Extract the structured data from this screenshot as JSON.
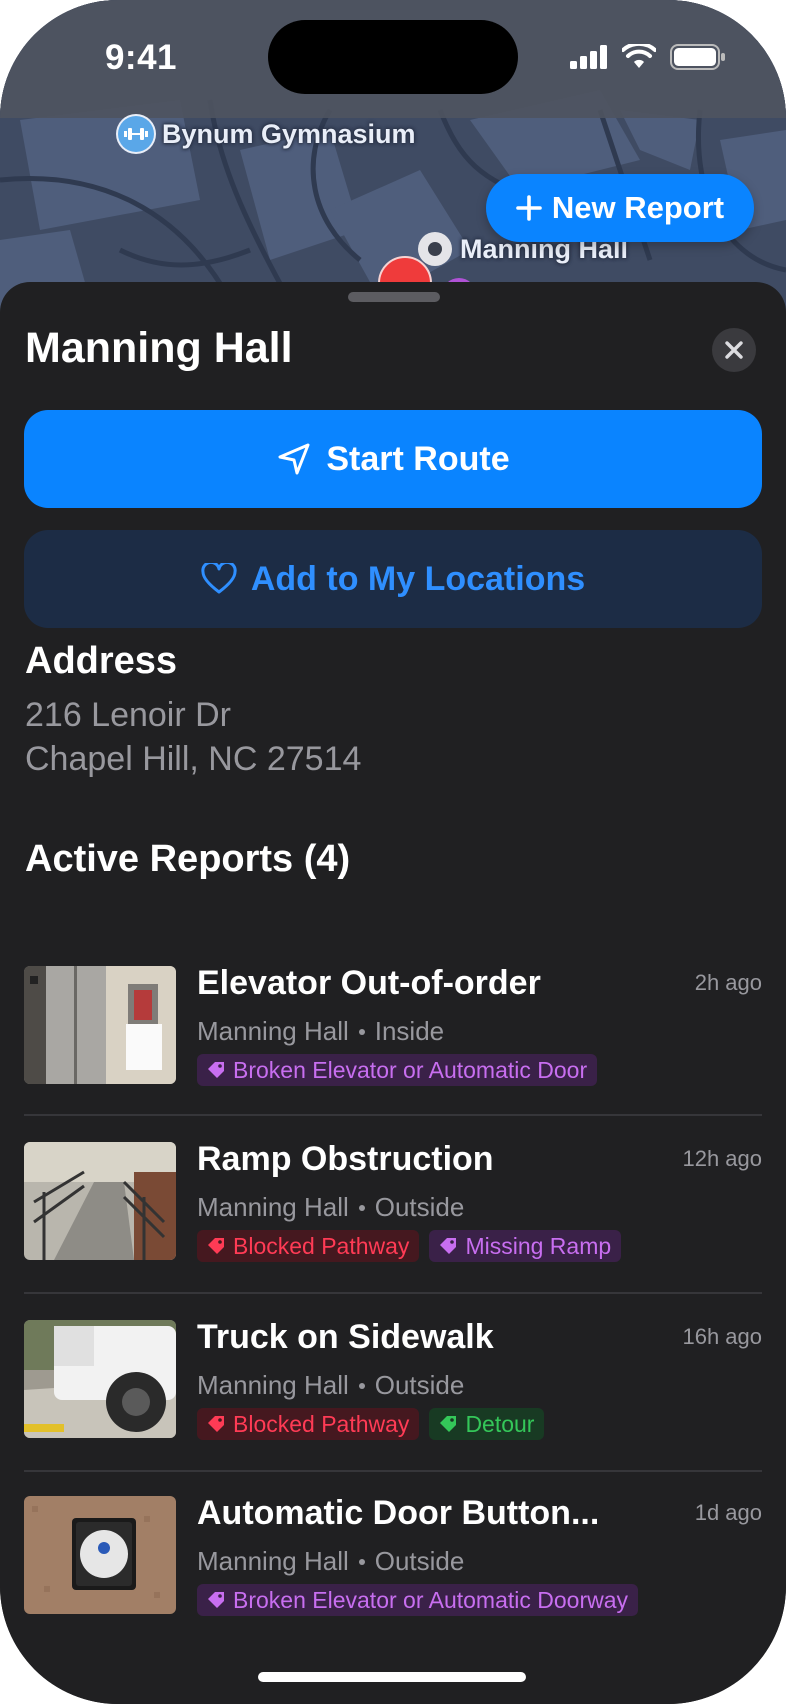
{
  "status_bar": {
    "time": "9:41"
  },
  "map": {
    "poi_gym": "Bynum Gymnasium",
    "poi_manning": "Manning Hall",
    "new_report_label": "New Report"
  },
  "sheet": {
    "title": "Manning Hall",
    "start_route_label": "Start Route",
    "add_location_label": "Add to My Locations",
    "address_heading": "Address",
    "address_line1": "216 Lenoir Dr",
    "address_line2": "Chapel Hill, NC 27514",
    "reports_heading": "Active Reports (4)"
  },
  "reports": [
    {
      "title": "Elevator Out-of-order",
      "time": "2h ago",
      "building": "Manning Hall",
      "location": "Inside",
      "tags": [
        {
          "label": "Broken Elevator or Automatic Door",
          "color": "purple"
        }
      ]
    },
    {
      "title": "Ramp Obstruction",
      "time": "12h ago",
      "building": "Manning Hall",
      "location": "Outside",
      "tags": [
        {
          "label": "Blocked Pathway",
          "color": "red"
        },
        {
          "label": "Missing Ramp",
          "color": "purple"
        }
      ]
    },
    {
      "title": "Truck on Sidewalk",
      "time": "16h ago",
      "building": "Manning Hall",
      "location": "Outside",
      "tags": [
        {
          "label": "Blocked Pathway",
          "color": "red"
        },
        {
          "label": "Detour",
          "color": "green"
        }
      ]
    },
    {
      "title": "Automatic Door Button...",
      "time": "1d ago",
      "building": "Manning Hall",
      "location": "Outside",
      "tags": [
        {
          "label": "Broken Elevator or Automatic Doorway",
          "color": "purple"
        }
      ]
    }
  ],
  "colors": {
    "accent": "#0a84ff",
    "sheet_bg": "#202022",
    "tag_purple": "#c86ef0",
    "tag_red": "#ff3b55",
    "tag_green": "#34c759"
  },
  "icons": {
    "new_report": "plus-icon",
    "close": "close-icon",
    "start_route": "navigation-arrow-icon",
    "add_location": "heart-icon",
    "tag": "tag-icon"
  }
}
